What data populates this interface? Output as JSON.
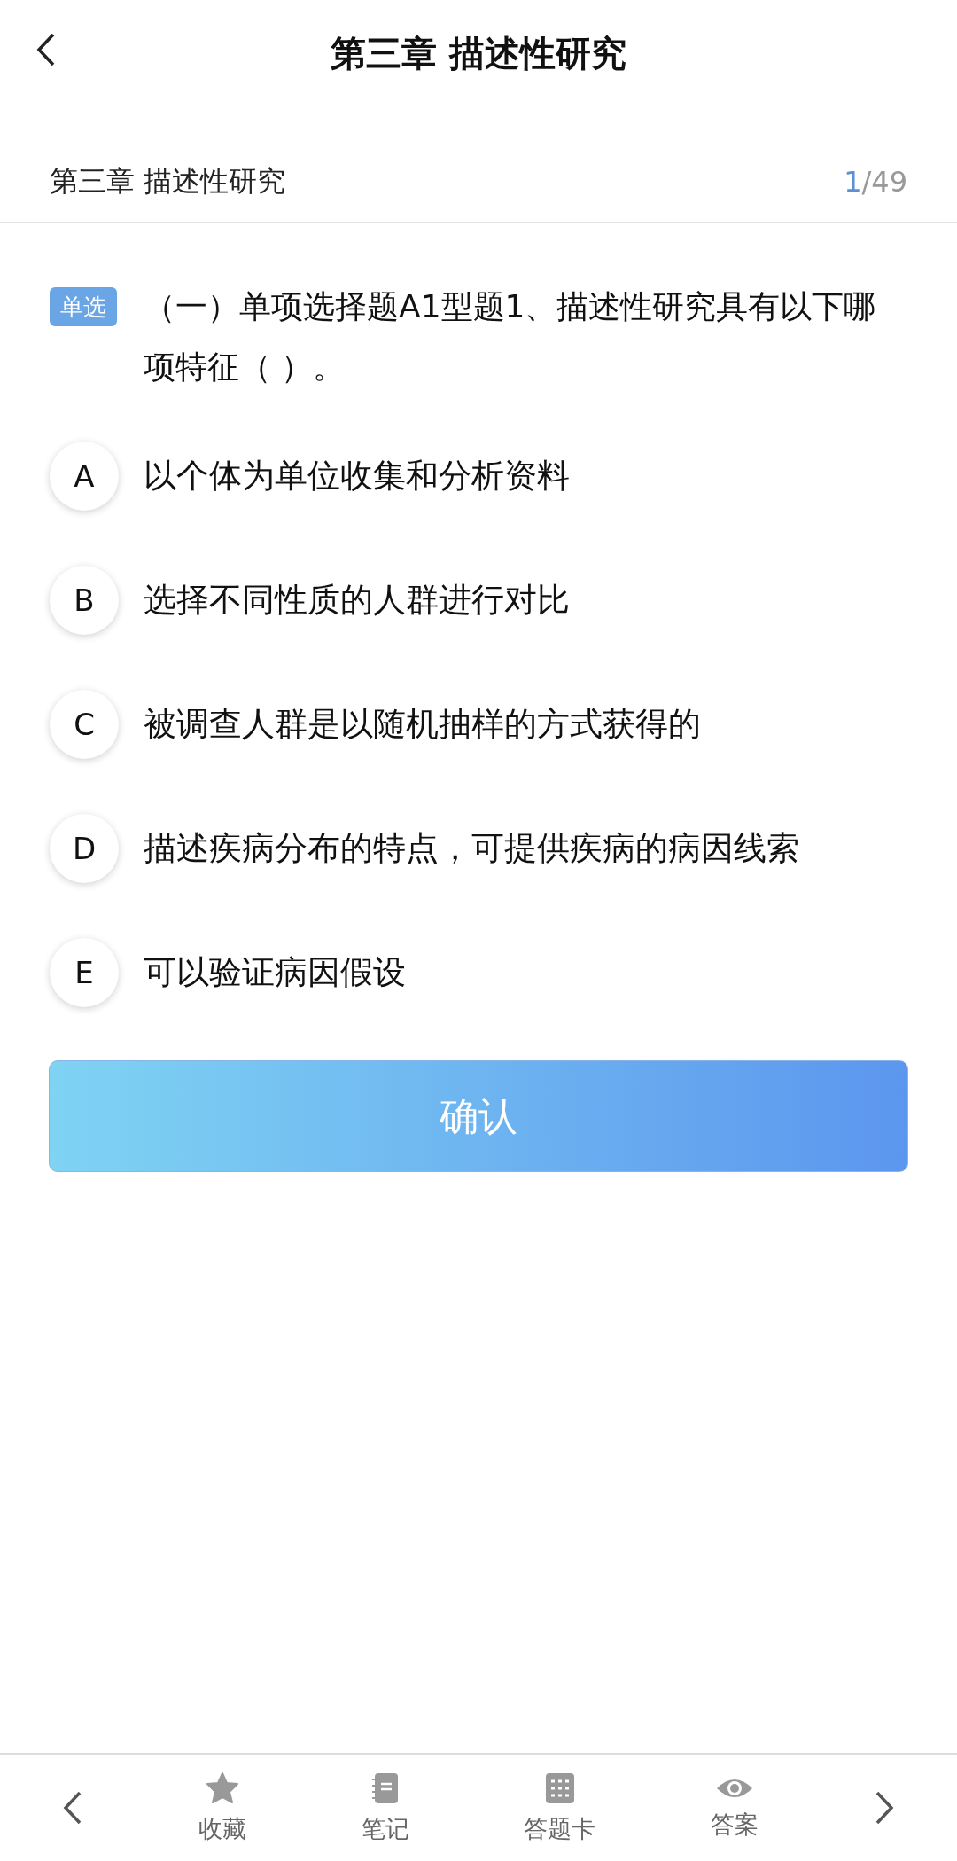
{
  "header": {
    "title": "第三章 描述性研究"
  },
  "subheader": {
    "chapter": "第三章 描述性研究",
    "counter_current": "1",
    "counter_rest": "/49"
  },
  "question": {
    "type_badge": "单选",
    "text": "（一）单项选择题A1型题1、描述性研究具有以下哪项特征（  ）。"
  },
  "options": [
    {
      "letter": "A",
      "text": "以个体为单位收集和分析资料",
      "selected": false
    },
    {
      "letter": "B",
      "text": "选择不同性质的人群进行对比",
      "selected": false
    },
    {
      "letter": "C",
      "text": "被调查人群是以随机抽样的方式获得的",
      "selected": false
    },
    {
      "letter": "D",
      "text": "描述疾病分布的特点，可提供疾病的病因线索",
      "selected": false
    },
    {
      "letter": "E",
      "text": "可以验证病因假设",
      "selected": false
    }
  ],
  "confirm_button": "确认",
  "bottom_bar": [
    {
      "kind": "star",
      "label": "收藏"
    },
    {
      "kind": "notebook",
      "label": "笔记"
    },
    {
      "kind": "grid",
      "label": "答题卡"
    },
    {
      "kind": "eye",
      "label": "答案"
    }
  ]
}
